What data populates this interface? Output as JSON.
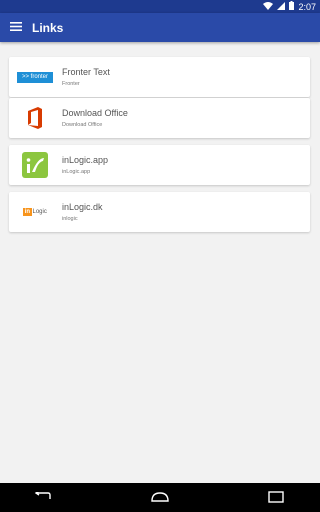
{
  "status_bar": {
    "time": "2:07",
    "icons": [
      "wifi-icon",
      "signal-icon",
      "battery-icon"
    ]
  },
  "app_bar": {
    "title": "Links",
    "menu_icon": "hamburger-menu-icon",
    "color": "#2a4aa8"
  },
  "links": [
    {
      "title": "Fronter Text",
      "subtitle": "Fronter",
      "logo_text": ">> fronter",
      "logo_color": "#1e8fd6"
    },
    {
      "title": "Download Office",
      "subtitle": "Download Office",
      "logo_color": "#d83b01"
    },
    {
      "title": "inLogic.app",
      "subtitle": "inLogic.app",
      "logo_color": "#8cc63f"
    },
    {
      "title": "inLogic.dk",
      "subtitle": "inlogic",
      "logo_text_in": "in",
      "logo_text_rest": "Logic",
      "logo_color": "#f7941d"
    }
  ],
  "nav_bar": {
    "icons": [
      "back-icon",
      "home-icon",
      "recents-icon"
    ]
  }
}
